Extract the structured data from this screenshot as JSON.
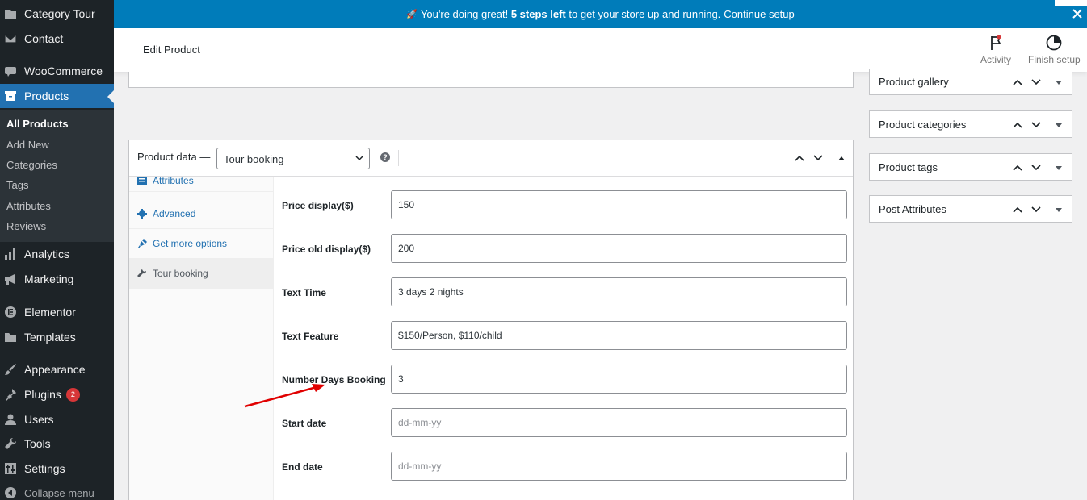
{
  "sidebar": {
    "items": [
      {
        "label": "Category Tour",
        "icon": "category-icon"
      },
      {
        "label": "Contact",
        "icon": "mail-icon"
      },
      {
        "label": "WooCommerce",
        "icon": "woocommerce-icon"
      },
      {
        "label": "Products",
        "icon": "archive-icon"
      },
      {
        "label": "Analytics",
        "icon": "bar-chart-icon"
      },
      {
        "label": "Marketing",
        "icon": "megaphone-icon"
      },
      {
        "label": "Elementor",
        "icon": "elementor-icon"
      },
      {
        "label": "Templates",
        "icon": "folder-icon"
      },
      {
        "label": "Appearance",
        "icon": "paintbrush-icon"
      },
      {
        "label": "Plugins",
        "icon": "plugin-icon"
      },
      {
        "label": "Users",
        "icon": "user-icon"
      },
      {
        "label": "Tools",
        "icon": "wrench-icon"
      },
      {
        "label": "Settings",
        "icon": "settings-icon"
      }
    ],
    "plugins_badge": "2",
    "collapse_label": "Collapse menu",
    "submenu": [
      "All Products",
      "Add New",
      "Categories",
      "Tags",
      "Attributes",
      "Reviews"
    ]
  },
  "notice": {
    "emoji": "🚀",
    "pre": "You're doing great!",
    "bold": "5 steps left",
    "post": "to get your store up and running.",
    "link": "Continue setup"
  },
  "header": {
    "title": "Edit Product",
    "activity_label": "Activity",
    "finish_label": "Finish setup"
  },
  "product_data": {
    "label": "Product data —",
    "type_value": "Tour booking",
    "help": "?",
    "tabs": [
      {
        "label": "Attributes",
        "icon": "list-icon"
      },
      {
        "label": "Advanced",
        "icon": "gear-icon"
      },
      {
        "label": "Get more options",
        "icon": "plug-icon"
      },
      {
        "label": "Tour booking",
        "icon": "wrench-icon"
      }
    ],
    "fields": [
      {
        "label": "Price display($)",
        "value": "150",
        "placeholder": ""
      },
      {
        "label": "Price old display($)",
        "value": "200",
        "placeholder": ""
      },
      {
        "label": "Text Time",
        "value": "3 days 2 nights",
        "placeholder": ""
      },
      {
        "label": "Text Feature",
        "value": "$150/Person, $110/child",
        "placeholder": ""
      },
      {
        "label": "Number Days Booking",
        "value": "3",
        "placeholder": ""
      },
      {
        "label": "Start date",
        "value": "",
        "placeholder": "dd-mm-yy"
      },
      {
        "label": "End date",
        "value": "",
        "placeholder": "dd-mm-yy"
      }
    ]
  },
  "side_boxes": [
    {
      "title": "Product gallery"
    },
    {
      "title": "Product categories"
    },
    {
      "title": "Product tags"
    },
    {
      "title": "Post Attributes"
    }
  ],
  "colors": {
    "sidebar_bg": "#1d2327",
    "accent": "#2271b1",
    "notice_bg": "#007cba",
    "annotation_arrow": "#e00000"
  }
}
